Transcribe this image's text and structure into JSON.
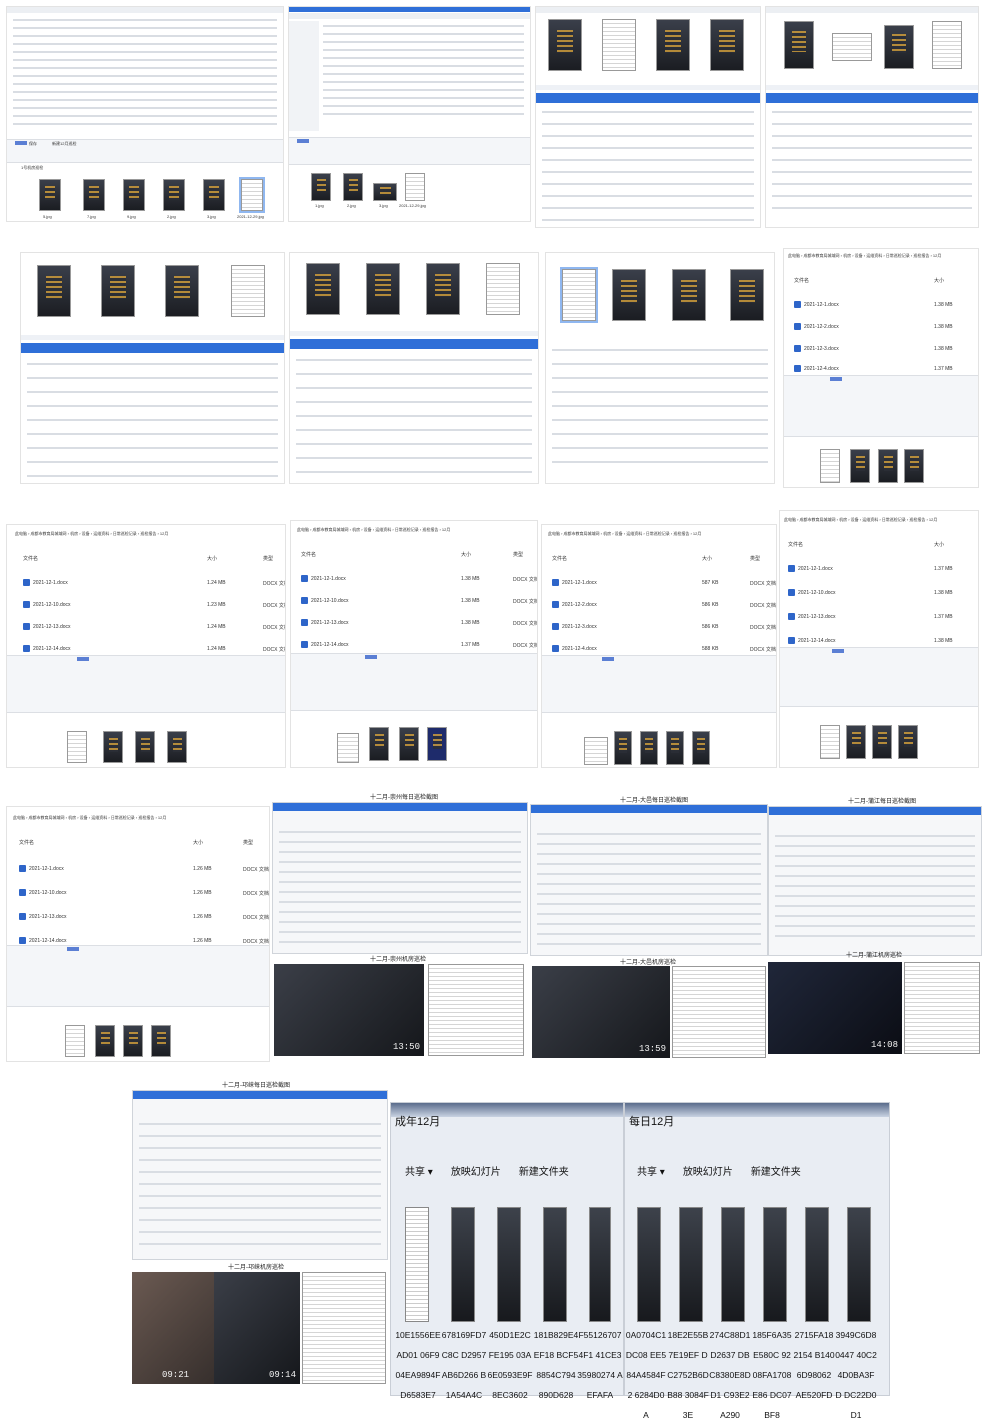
{
  "explorer": {
    "save_label": "保存",
    "folder_title": "新建12月巡检",
    "sidebar_label": "1号机房巡检",
    "share_tab": "共享",
    "view_tab": "查看"
  },
  "row1_thumbs": [
    "5.jpg",
    "7.jpg",
    "9.jpg",
    "2.jpg",
    "3.jpg",
    "2021-12-29.jpg"
  ],
  "row1b_thumbs": [
    "1.jpg",
    "2.jpg",
    "3.jpg",
    "2021-12-29.jpg"
  ],
  "breadcrumb": "此电脑 › 成都市教育局城域网 › 机房 › 设备 › 运维资料 › 日常巡检记录 › 巡检报告 › 12月",
  "columns": {
    "name": "文件名",
    "size": "大小",
    "type": "类型"
  },
  "docx_type": "DOCX 文档",
  "panels": [
    {
      "files": [
        "2021-12-1.docx",
        "2021-12-2.docx",
        "2021-12-3.docx",
        "2021-12-4.docx"
      ],
      "sizes": [
        "1.38 MB",
        "1.38 MB",
        "1.38 MB",
        "1.37 MB"
      ]
    },
    {
      "files": [
        "2021-12-1.docx",
        "2021-12-10.docx",
        "2021-12-13.docx",
        "2021-12-14.docx"
      ],
      "sizes": [
        "1.24 MB",
        "1.23 MB",
        "1.24 MB",
        "1.24 MB"
      ]
    },
    {
      "files": [
        "2021-12-1.docx",
        "2021-12-10.docx",
        "2021-12-13.docx",
        "2021-12-14.docx"
      ],
      "sizes": [
        "1.38 MB",
        "1.38 MB",
        "1.38 MB",
        "1.37 MB"
      ]
    },
    {
      "files": [
        "2021-12-1.docx",
        "2021-12-2.docx",
        "2021-12-3.docx",
        "2021-12-4.docx"
      ],
      "sizes": [
        "587 KB",
        "586 KB",
        "586 KB",
        "588 KB"
      ]
    },
    {
      "files": [
        "2021-12-1.docx",
        "2021-12-10.docx",
        "2021-12-13.docx",
        "2021-12-14.docx"
      ],
      "sizes": [
        "1.37 MB",
        "1.38 MB",
        "1.37 MB",
        "1.38 MB"
      ]
    },
    {
      "files": [
        "2021-12-1.docx",
        "2021-12-10.docx",
        "2021-12-13.docx",
        "2021-12-14.docx"
      ],
      "sizes": [
        "1.26 MB",
        "1.26 MB",
        "1.26 MB",
        "1.26 MB"
      ]
    }
  ],
  "captions": {
    "c1": "十二月-崇州每日巡检截图",
    "c2": "十二月-大邑每日巡检截图",
    "c3": "十二月-蒲江每日巡检截图",
    "c4": "十二月-崇州机房巡检",
    "c5": "十二月-大邑机房巡检",
    "c6": "十二月-蒲江机房巡检",
    "c7": "十二月-邛崃每日巡检截图",
    "c8": "十二月-邛崃机房巡检"
  },
  "photo_stamps": [
    "13:50",
    "13:59",
    "14:08",
    "09:21",
    "09:14"
  ],
  "zoom_left": {
    "title": "成年12月",
    "menu": [
      "共享 ▾",
      "放映幻灯片",
      "新建文件夹"
    ],
    "codes": [
      "10E1556EEAD01 06F904EA9894F D6583E7",
      "678169FD7C8C D2957AB6D266 B1A54A4C",
      "450D1E2CFE195 03A6E0593E9F 8EC3602",
      "181B829E4EF18 BCF58854C794 890D628",
      "F551267074F1 41CE335980274 AEFAFA"
    ]
  },
  "zoom_right": {
    "title": "每日12月",
    "menu": [
      "共享 ▾",
      "放映幻灯片",
      "新建文件夹"
    ],
    "codes": [
      "0A0704C1DC08 EE584A4584F2 6284D0A",
      "18E2E55B7E19EF DC2752B6DB88 3084F3E",
      "274C88D1D2637 DBC8380E8DD1 C93E2A290",
      "185F6A35E580C 9208FA1708E86 DC07BF8",
      "2715FA182154 B1406D98062 AE520FD",
      "3949C6D80447 40C24D0BA3FD DC22D0D1"
    ]
  }
}
